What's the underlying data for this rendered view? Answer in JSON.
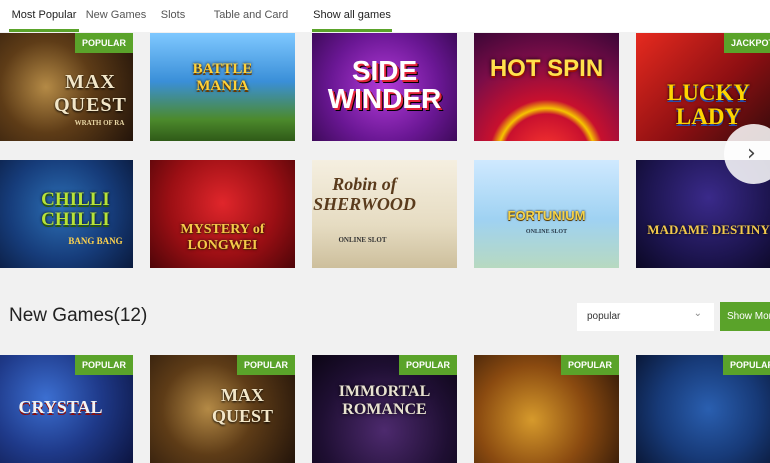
{
  "tabs": [
    {
      "label": "Most Popular"
    },
    {
      "label": "New Games"
    },
    {
      "label": "Slots"
    },
    {
      "label": "Table and Card Games"
    },
    {
      "label": "Show all games"
    }
  ],
  "popular_games": [
    {
      "title": "MAX QUEST",
      "subtitle": "WRATH OF RA",
      "badge": "POPULAR"
    },
    {
      "title": "BATTLE MANIA",
      "subtitle": "",
      "badge": ""
    },
    {
      "title": "SIDE WINDER",
      "subtitle": "",
      "badge": ""
    },
    {
      "title": "HOT SPIN",
      "subtitle": "",
      "badge": ""
    },
    {
      "title": "LUCKY LADY",
      "subtitle": "",
      "badge": "JACKPOT"
    },
    {
      "title": "CHILLI CHILLI",
      "subtitle": "BANG BANG",
      "badge": ""
    },
    {
      "title": "MYSTERY of LONGWEI",
      "subtitle": "",
      "badge": ""
    },
    {
      "title": "Robin of SHERWOOD",
      "subtitle": "ONLINE SLOT",
      "badge": ""
    },
    {
      "title": "FORTUNIUM",
      "subtitle": "ONLINE SLOT",
      "badge": ""
    },
    {
      "title": "MADAME DESTINY",
      "subtitle": "",
      "badge": ""
    }
  ],
  "new_games_section": {
    "title": "New Games(12)",
    "sort_value": "popular",
    "show_more_label": "Show More"
  },
  "new_games": [
    {
      "title": "CRYSTAL",
      "badge": "POPULAR"
    },
    {
      "title": "MAX QUEST",
      "badge": "POPULAR"
    },
    {
      "title": "IMMORTAL ROMANCE",
      "badge": "POPULAR"
    },
    {
      "title": "",
      "badge": "POPULAR"
    },
    {
      "title": "",
      "badge": "POPULAR"
    }
  ],
  "icons": {
    "next": "chevron-right-icon",
    "dropdown": "chevron-down-icon"
  },
  "colors": {
    "accent": "#5aa32a",
    "page_bg": "#f1f1f1"
  }
}
